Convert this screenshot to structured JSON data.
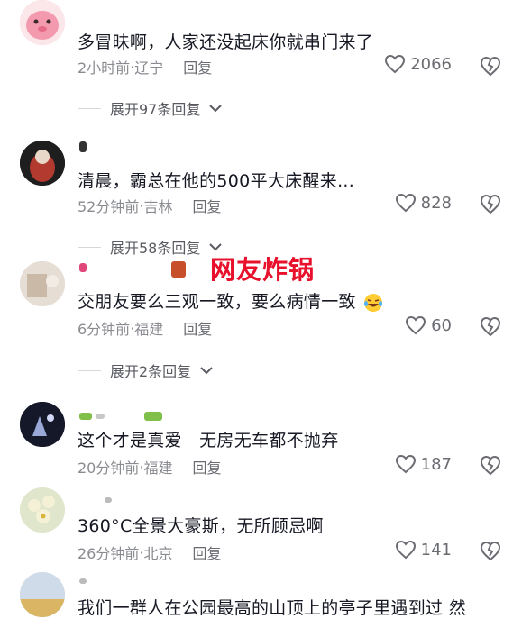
{
  "comments": [
    {
      "text": "多冒昧啊，人家还没起床你就串门来了",
      "time": "2小时前",
      "location": "辽宁",
      "reply_label": "回复",
      "likes": "2066",
      "expand_label": "展开97条回复"
    },
    {
      "text": "清晨，霸总在他的500平大床醒来...",
      "time": "52分钟前",
      "location": "吉林",
      "reply_label": "回复",
      "likes": "828",
      "expand_label": "展开58条回复"
    },
    {
      "text": "交朋友要么三观一致，要么病情一致",
      "time": "6分钟前",
      "location": "福建",
      "reply_label": "回复",
      "likes": "60",
      "expand_label": "展开2条回复"
    },
    {
      "text": "这个才是真爱　无房无车都不抛弃",
      "time": "20分钟前",
      "location": "福建",
      "reply_label": "回复",
      "likes": "187"
    },
    {
      "text": "360°C全景大豪斯，无所顾忌啊",
      "time": "26分钟前",
      "location": "北京",
      "reply_label": "回复",
      "likes": "141"
    },
    {
      "text": "我们一群人在公园最高的山顶上的亭子里遇到过 然"
    }
  ],
  "overlay_text": "网友炸锅",
  "meta_separator": " · ",
  "colors": {
    "overlay": "#e8102a",
    "meta": "#8a8b91",
    "text": "#161823"
  },
  "icons": {
    "like": "heart-outline-icon",
    "dislike": "broken-heart-icon",
    "expand": "chevron-down-icon"
  }
}
